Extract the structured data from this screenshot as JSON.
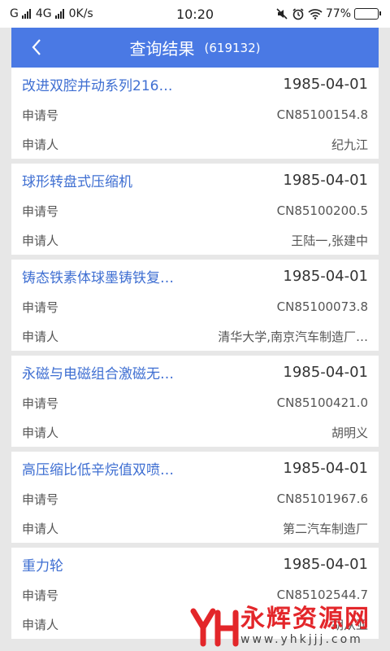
{
  "status_bar": {
    "carrier": "G",
    "network": "4G",
    "speed": "0K/s",
    "time": "10:20",
    "battery": "77%",
    "battery_level": 0.77
  },
  "header": {
    "title": "查询结果",
    "count": "(619132)",
    "background_color": "#4a79e4"
  },
  "results": [
    {
      "title": "改进双腔并动系列216…",
      "date": "1985-04-01",
      "app_no_label": "申请号",
      "app_no": "CN85100154.8",
      "applicant_label": "申请人",
      "applicant": "纪九江"
    },
    {
      "title": "球形转盘式压缩机",
      "date": "1985-04-01",
      "app_no_label": "申请号",
      "app_no": "CN85100200.5",
      "applicant_label": "申请人",
      "applicant": "王陆一,张建中"
    },
    {
      "title": "铸态铁素体球墨铸铁复…",
      "date": "1985-04-01",
      "app_no_label": "申请号",
      "app_no": "CN85100073.8",
      "applicant_label": "申请人",
      "applicant": "清华大学,南京汽车制造厂…"
    },
    {
      "title": "永磁与电磁组合激磁无…",
      "date": "1985-04-01",
      "app_no_label": "申请号",
      "app_no": "CN85100421.0",
      "applicant_label": "申请人",
      "applicant": "胡明义"
    },
    {
      "title": "高压缩比低辛烷值双喷…",
      "date": "1985-04-01",
      "app_no_label": "申请号",
      "app_no": "CN85101967.6",
      "applicant_label": "申请人",
      "applicant": "第二汽车制造厂"
    },
    {
      "title": "重力轮",
      "date": "1985-04-01",
      "app_no_label": "申请号",
      "app_no": "CN85102544.7",
      "applicant_label": "申请人",
      "applicant": "胡从亚"
    }
  ],
  "watermark": {
    "name": "永辉资源网",
    "url": "www.yhkjjj.com",
    "color": "#e3262a"
  }
}
